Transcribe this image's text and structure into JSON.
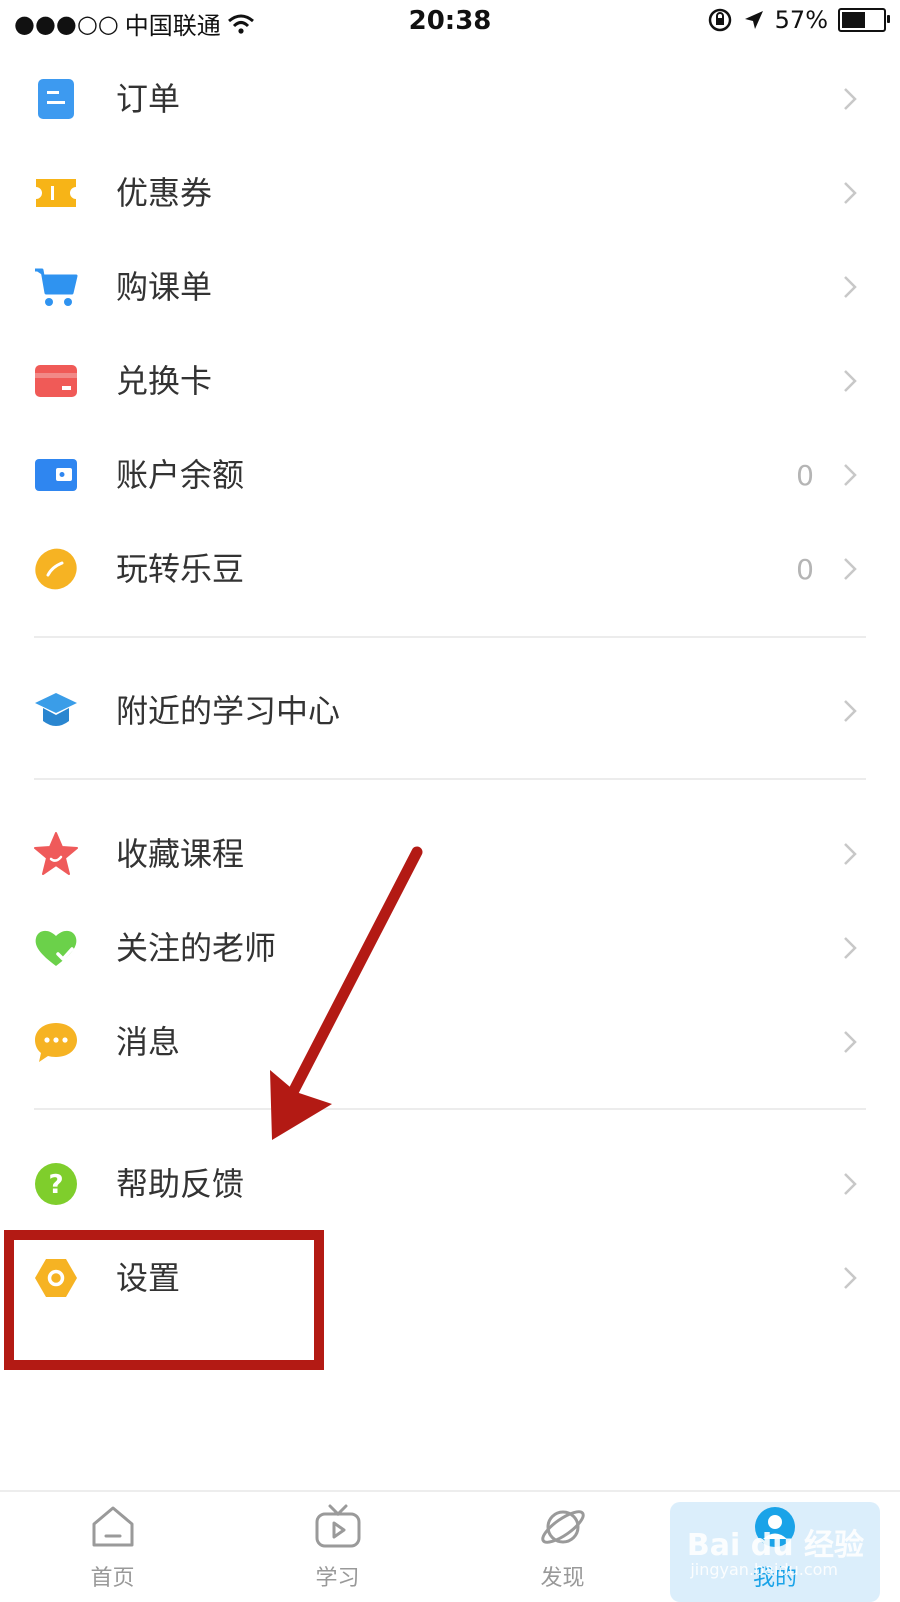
{
  "status_bar": {
    "signal": "●●●○○",
    "carrier": "中国联通",
    "time": "20:38",
    "battery_text": "57%",
    "battery_level": 0.57
  },
  "menu": {
    "items": [
      {
        "label": "订单",
        "icon": "order-icon",
        "color": "#3d9af0"
      },
      {
        "label": "优惠券",
        "icon": "coupon-icon",
        "color": "#f7b417"
      },
      {
        "label": "购课单",
        "icon": "cart-icon",
        "color": "#2f93f0"
      },
      {
        "label": "兑换卡",
        "icon": "card-icon",
        "color": "#f05a57"
      },
      {
        "label": "账户余额",
        "icon": "wallet-icon",
        "color": "#2f86f0",
        "value": "0"
      },
      {
        "label": "玩转乐豆",
        "icon": "bean-icon",
        "color": "#f6b323",
        "value": "0"
      },
      {
        "label": "附近的学习中心",
        "icon": "graduation-cap-icon",
        "color": "#3a9de8"
      },
      {
        "label": "收藏课程",
        "icon": "star-icon",
        "color": "#ef5a5a"
      },
      {
        "label": "关注的老师",
        "icon": "heart-check-icon",
        "color": "#6bd14a"
      },
      {
        "label": "消息",
        "icon": "chat-bubble-icon",
        "color": "#f6b323"
      },
      {
        "label": "帮助反馈",
        "icon": "help-icon",
        "color": "#7fce2c"
      },
      {
        "label": "设置",
        "icon": "settings-hexagon-icon",
        "color": "#f6b323"
      }
    ]
  },
  "tabbar": {
    "tabs": [
      {
        "label": "首页",
        "icon": "home-icon"
      },
      {
        "label": "学习",
        "icon": "tv-play-icon"
      },
      {
        "label": "发现",
        "icon": "planet-icon"
      },
      {
        "label": "我的",
        "icon": "profile-icon"
      }
    ],
    "active_color": "#1aa3e8"
  },
  "watermark": {
    "title": "Bai du 经验",
    "url": "jingyan.baidu.com"
  },
  "annotation": {
    "color": "#b31a14"
  }
}
